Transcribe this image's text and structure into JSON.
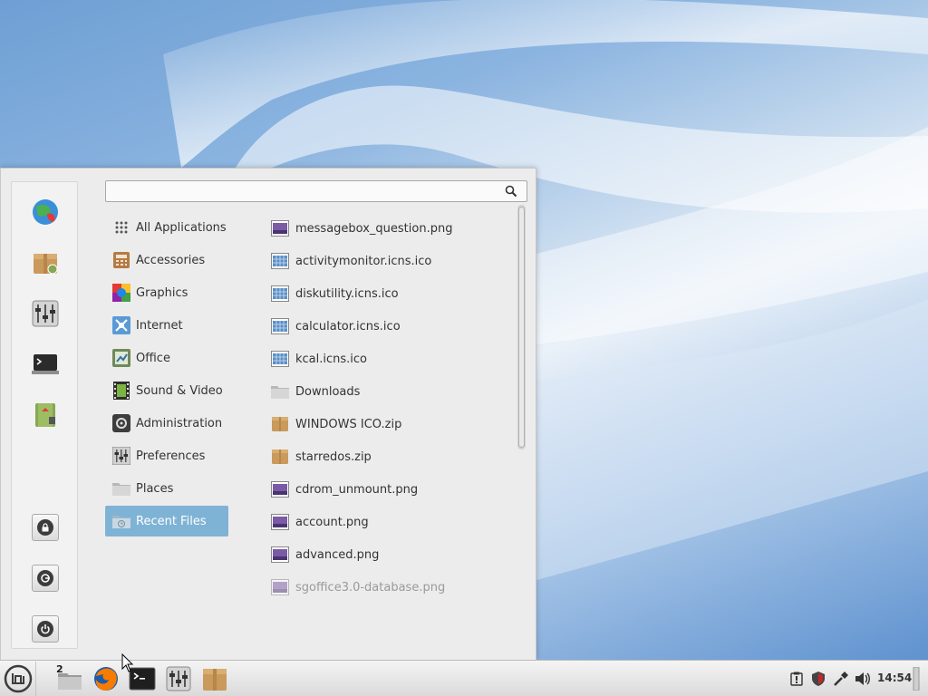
{
  "colors": {
    "selected_bg": "#7fb3d5",
    "menu_bg": "#ececec",
    "taskbar_bg": "#e6e6e6",
    "accent_green": "#87a752"
  },
  "favorites": [
    {
      "name": "firefox",
      "icon": "globe-icon"
    },
    {
      "name": "software-manager",
      "icon": "package-icon"
    },
    {
      "name": "settings",
      "icon": "sliders-icon"
    },
    {
      "name": "terminal",
      "icon": "terminal-icon"
    },
    {
      "name": "file-manager",
      "icon": "home-folder-icon"
    }
  ],
  "system_buttons": [
    {
      "name": "lock",
      "icon": "lock-icon"
    },
    {
      "name": "logout",
      "icon": "logout-icon"
    },
    {
      "name": "shutdown",
      "icon": "power-icon"
    }
  ],
  "search": {
    "value": "",
    "placeholder": ""
  },
  "categories": [
    {
      "label": "All Applications",
      "icon": "grid-icon"
    },
    {
      "label": "Accessories",
      "icon": "calculator-icon"
    },
    {
      "label": "Graphics",
      "icon": "color-wheel-icon"
    },
    {
      "label": "Internet",
      "icon": "network-icon"
    },
    {
      "label": "Office",
      "icon": "chart-icon"
    },
    {
      "label": "Sound & Video",
      "icon": "film-icon"
    },
    {
      "label": "Administration",
      "icon": "admin-icon"
    },
    {
      "label": "Preferences",
      "icon": "sliders-icon"
    },
    {
      "label": "Places",
      "icon": "folder-icon"
    },
    {
      "label": "Recent Files",
      "icon": "recent-folder-icon",
      "selected": true
    }
  ],
  "recent_files": [
    {
      "label": "messagebox_question.png",
      "icon": "image-icon"
    },
    {
      "label": "activitymonitor.icns.ico",
      "icon": "ico-icon"
    },
    {
      "label": "diskutility.icns.ico",
      "icon": "ico-icon"
    },
    {
      "label": "calculator.icns.ico",
      "icon": "ico-icon"
    },
    {
      "label": "kcal.icns.ico",
      "icon": "ico-icon"
    },
    {
      "label": "Downloads",
      "icon": "folder-icon"
    },
    {
      "label": "WINDOWS ICO.zip",
      "icon": "archive-icon"
    },
    {
      "label": "starredos.zip",
      "icon": "archive-icon"
    },
    {
      "label": "cdrom_unmount.png",
      "icon": "image-icon"
    },
    {
      "label": "account.png",
      "icon": "image-icon"
    },
    {
      "label": "advanced.png",
      "icon": "image-icon"
    },
    {
      "label": "sgoffice3.0-database.png",
      "icon": "image-icon",
      "faded": true
    }
  ],
  "taskbar": {
    "workspace_number": "2",
    "launchers": [
      "files-icon",
      "firefox-icon",
      "terminal-icon",
      "settings-icon",
      "package-icon"
    ],
    "tray": [
      "update-icon",
      "shield-icon",
      "network-icon",
      "volume-icon"
    ],
    "clock": "14:54"
  }
}
